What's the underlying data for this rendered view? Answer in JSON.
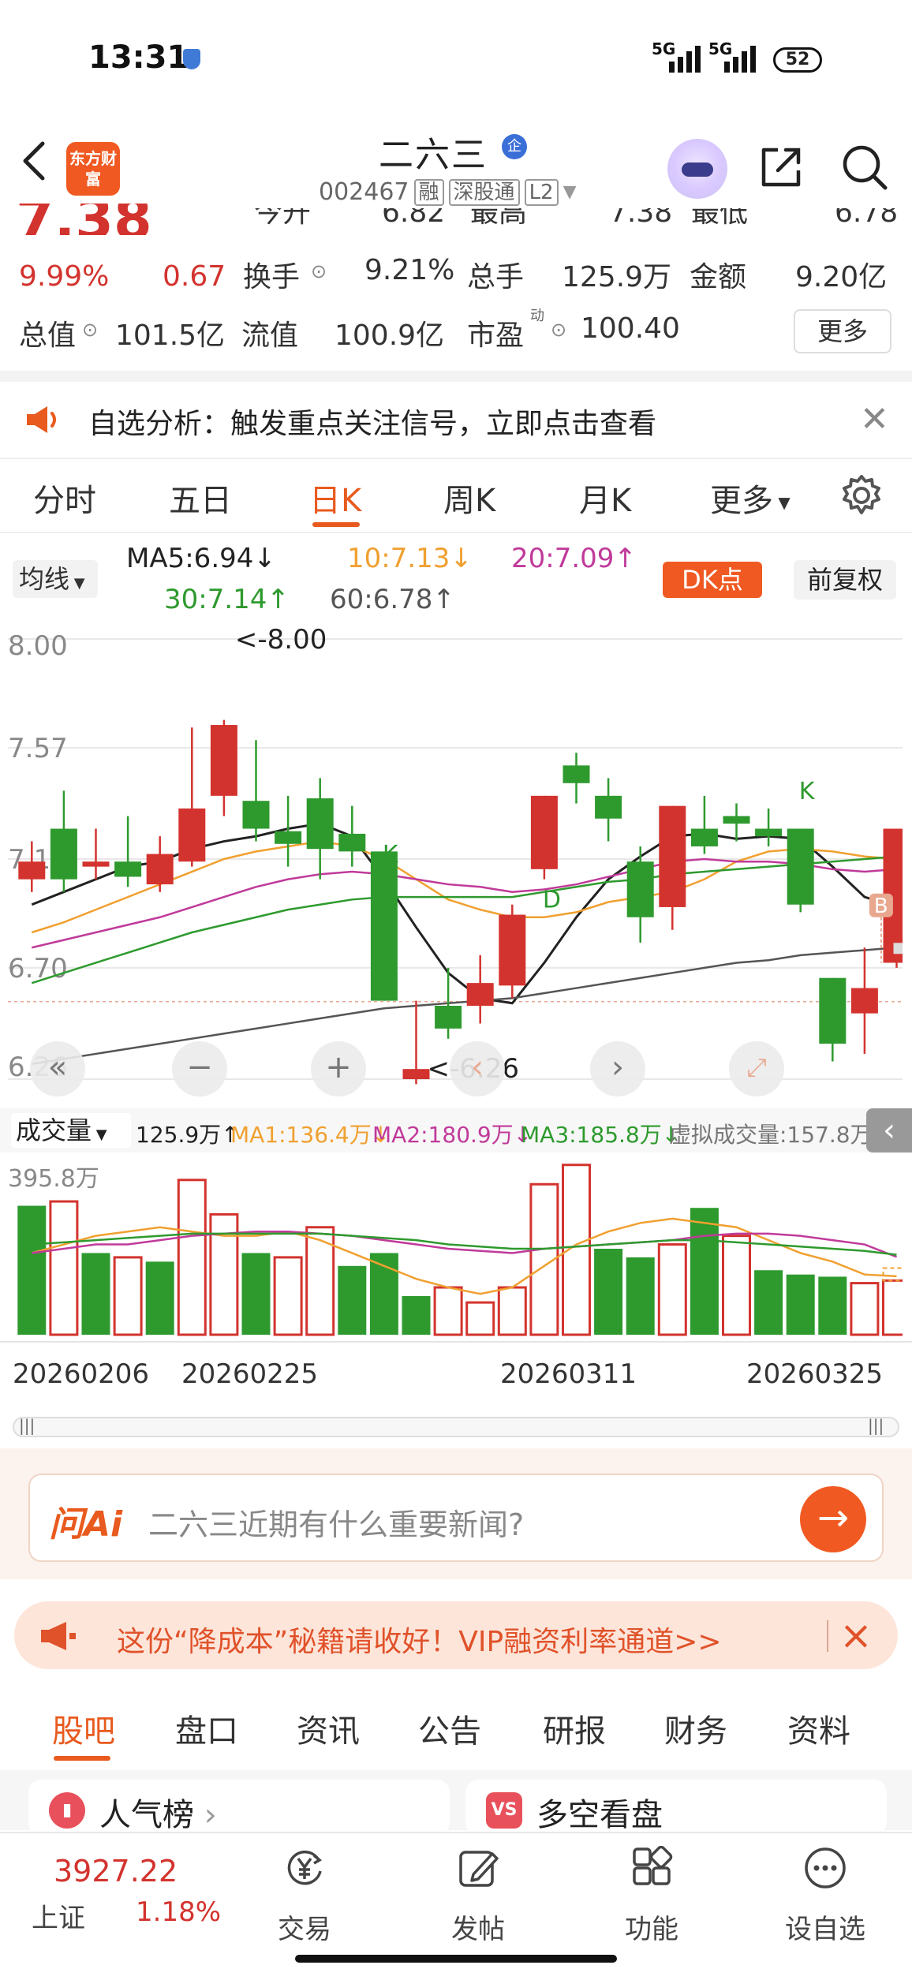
{
  "status": {
    "time": "13:31",
    "net1": "5G",
    "net2": "5G",
    "battery": "52"
  },
  "header": {
    "logo": "东方财富",
    "title": "二六三",
    "badge": "企",
    "code": "002467",
    "tags": [
      "融",
      "深股通",
      "L2"
    ]
  },
  "quote": {
    "price": "7.38",
    "change_pct": "9.99%",
    "change": "0.67",
    "row0": [
      "今开",
      "6.82",
      "最高",
      "7.38",
      "最低",
      "6.78"
    ],
    "turnover_label": "换手",
    "turnover": "9.21%",
    "volume_label": "总手",
    "volume": "125.9万",
    "amount_label": "金额",
    "amount": "9.20亿",
    "mktcap_label": "总值",
    "mktcap": "101.5亿",
    "float_label": "流值",
    "float": "100.9亿",
    "pe_label": "市盈",
    "pe_sup": "动",
    "pe": "100.40",
    "more": "更多"
  },
  "alert": {
    "text": "自选分析：触发重点关注信号，立即点击查看"
  },
  "tabs": [
    "分时",
    "五日",
    "日K",
    "周K",
    "月K",
    "更多"
  ],
  "active_tab": "日K",
  "ma": {
    "selector": "均线",
    "ma5": "MA5:6.94↓",
    "ma10": "10:7.13↓",
    "ma20": "20:7.09↑",
    "ma30": "30:7.14↑",
    "ma60": "60:6.78↑",
    "dk": "DK点",
    "adjust": "前复权"
  },
  "chart_data": {
    "type": "candlestick",
    "y_ticks": [
      "8.00",
      "7.57",
      "7.13",
      "6.70",
      "6.26"
    ],
    "ylim": [
      6.26,
      8.0
    ],
    "max_label": "<-8.00",
    "min_label": "<-6.26",
    "markers": [
      "K",
      "D",
      "K",
      "B"
    ],
    "candles": [
      {
        "o": 7.05,
        "c": 7.12,
        "h": 7.2,
        "l": 7.0
      },
      {
        "o": 7.25,
        "c": 7.05,
        "h": 7.4,
        "l": 7.0
      },
      {
        "o": 7.1,
        "c": 7.12,
        "h": 7.25,
        "l": 7.05
      },
      {
        "o": 7.12,
        "c": 7.06,
        "h": 7.3,
        "l": 7.02
      },
      {
        "o": 7.03,
        "c": 7.15,
        "h": 7.22,
        "l": 7.0
      },
      {
        "o": 7.12,
        "c": 7.33,
        "h": 7.65,
        "l": 7.1
      },
      {
        "o": 7.38,
        "c": 7.66,
        "h": 7.68,
        "l": 7.3
      },
      {
        "o": 7.36,
        "c": 7.25,
        "h": 7.6,
        "l": 7.2
      },
      {
        "o": 7.24,
        "c": 7.19,
        "h": 7.38,
        "l": 7.1
      },
      {
        "o": 7.37,
        "c": 7.17,
        "h": 7.45,
        "l": 7.05
      },
      {
        "o": 7.23,
        "c": 7.16,
        "h": 7.34,
        "l": 7.1
      },
      {
        "o": 7.16,
        "c": 6.57,
        "h": 7.16,
        "l": 6.57
      },
      {
        "o": 6.26,
        "c": 6.3,
        "h": 6.57,
        "l": 6.24
      },
      {
        "o": 6.55,
        "c": 6.46,
        "h": 6.7,
        "l": 6.42
      },
      {
        "o": 6.55,
        "c": 6.64,
        "h": 6.75,
        "l": 6.48
      },
      {
        "o": 6.63,
        "c": 6.91,
        "h": 6.95,
        "l": 6.58
      },
      {
        "o": 7.09,
        "c": 7.38,
        "h": 7.38,
        "l": 7.05
      },
      {
        "o": 7.5,
        "c": 7.43,
        "h": 7.55,
        "l": 7.35
      },
      {
        "o": 7.38,
        "c": 7.29,
        "h": 7.45,
        "l": 7.2
      },
      {
        "o": 7.12,
        "c": 6.9,
        "h": 7.18,
        "l": 6.8
      },
      {
        "o": 6.94,
        "c": 7.34,
        "h": 7.34,
        "l": 6.85
      },
      {
        "o": 7.25,
        "c": 7.18,
        "h": 7.38,
        "l": 7.15
      },
      {
        "o": 7.3,
        "c": 7.27,
        "h": 7.35,
        "l": 7.2
      },
      {
        "o": 7.25,
        "c": 7.22,
        "h": 7.33,
        "l": 7.18
      },
      {
        "o": 7.25,
        "c": 6.95,
        "h": 7.25,
        "l": 6.92
      },
      {
        "o": 6.66,
        "c": 6.4,
        "h": 6.66,
        "l": 6.33
      },
      {
        "o": 6.52,
        "c": 6.62,
        "h": 6.78,
        "l": 6.36
      },
      {
        "o": 6.72,
        "c": 7.25,
        "h": 7.25,
        "l": 6.7
      }
    ],
    "series": [
      {
        "name": "MA5",
        "color": "#222222",
        "values": [
          6.95,
          7.0,
          7.05,
          7.1,
          7.12,
          7.17,
          7.2,
          7.22,
          7.25,
          7.27,
          7.22,
          7.05,
          6.86,
          6.68,
          6.58,
          6.56,
          6.72,
          6.9,
          7.05,
          7.14,
          7.22,
          7.23,
          7.21,
          7.22,
          7.21,
          7.1,
          6.98,
          6.94
        ]
      },
      {
        "name": "MA10",
        "color": "#f0a030",
        "values": [
          6.84,
          6.88,
          6.93,
          6.98,
          7.03,
          7.08,
          7.13,
          7.16,
          7.18,
          7.2,
          7.18,
          7.13,
          7.05,
          6.97,
          6.93,
          6.9,
          6.9,
          6.92,
          6.96,
          6.98,
          7.0,
          7.05,
          7.12,
          7.16,
          7.17,
          7.16,
          7.14,
          7.13
        ]
      },
      {
        "name": "MA20",
        "color": "#c03a9a",
        "values": [
          6.78,
          6.81,
          6.84,
          6.87,
          6.9,
          6.94,
          6.98,
          7.02,
          7.05,
          7.07,
          7.08,
          7.07,
          7.05,
          7.03,
          7.02,
          7.0,
          7.01,
          7.03,
          7.06,
          7.09,
          7.12,
          7.13,
          7.12,
          7.12,
          7.11,
          7.09,
          7.08,
          7.09
        ]
      },
      {
        "name": "MA30",
        "color": "#2e9a2e",
        "values": [
          6.64,
          6.68,
          6.72,
          6.76,
          6.8,
          6.84,
          6.87,
          6.9,
          6.93,
          6.95,
          6.97,
          6.98,
          6.98,
          6.98,
          6.98,
          6.98,
          7.0,
          7.02,
          7.04,
          7.05,
          7.07,
          7.08,
          7.09,
          7.1,
          7.11,
          7.12,
          7.13,
          7.14
        ]
      },
      {
        "name": "MA60",
        "color": "#555555",
        "values": [
          6.32,
          6.34,
          6.36,
          6.38,
          6.4,
          6.42,
          6.44,
          6.46,
          6.48,
          6.5,
          6.52,
          6.54,
          6.55,
          6.56,
          6.57,
          6.58,
          6.6,
          6.62,
          6.64,
          6.66,
          6.68,
          6.7,
          6.72,
          6.73,
          6.75,
          6.76,
          6.77,
          6.78
        ]
      }
    ]
  },
  "volume": {
    "selector": "成交量",
    "total": "125.9万↑",
    "ma1": "MA1:136.4万↓",
    "ma2": "MA2:180.9万↓",
    "ma3": "MA3:185.8万↓",
    "virtual": "虚拟成交量:157.8万",
    "max_label": "395.8万",
    "bars": [
      {
        "v": 3.0,
        "up": false
      },
      {
        "v": 3.1,
        "up": true
      },
      {
        "v": 1.9,
        "up": false
      },
      {
        "v": 1.8,
        "up": true
      },
      {
        "v": 1.7,
        "up": false
      },
      {
        "v": 3.6,
        "up": true
      },
      {
        "v": 2.8,
        "up": true
      },
      {
        "v": 1.9,
        "up": false
      },
      {
        "v": 1.8,
        "up": true
      },
      {
        "v": 2.5,
        "up": true
      },
      {
        "v": 1.6,
        "up": false
      },
      {
        "v": 1.9,
        "up": false
      },
      {
        "v": 0.9,
        "up": false
      },
      {
        "v": 1.1,
        "up": true
      },
      {
        "v": 0.75,
        "up": true
      },
      {
        "v": 1.1,
        "up": true
      },
      {
        "v": 3.5,
        "up": true
      },
      {
        "v": 3.95,
        "up": true
      },
      {
        "v": 2.0,
        "up": false
      },
      {
        "v": 1.8,
        "up": false
      },
      {
        "v": 2.1,
        "up": true
      },
      {
        "v": 2.95,
        "up": false
      },
      {
        "v": 2.3,
        "up": true
      },
      {
        "v": 1.5,
        "up": false
      },
      {
        "v": 1.4,
        "up": false
      },
      {
        "v": 1.35,
        "up": false
      },
      {
        "v": 1.2,
        "up": true
      },
      {
        "v": 1.26,
        "up": true
      }
    ],
    "ma_lines": [
      {
        "color": "#f0a030",
        "values": [
          1.9,
          2.1,
          2.3,
          2.4,
          2.5,
          2.4,
          2.3,
          2.3,
          2.4,
          2.2,
          1.9,
          1.6,
          1.3,
          1.1,
          0.95,
          1.1,
          1.6,
          2.1,
          2.4,
          2.6,
          2.7,
          2.6,
          2.5,
          2.2,
          1.9,
          1.7,
          1.4,
          1.36
        ]
      },
      {
        "color": "#c03a9a",
        "values": [
          1.9,
          2.0,
          2.1,
          2.1,
          2.2,
          2.3,
          2.35,
          2.4,
          2.4,
          2.35,
          2.3,
          2.2,
          2.1,
          2.0,
          1.95,
          1.9,
          2.0,
          2.05,
          2.1,
          2.15,
          2.2,
          2.3,
          2.35,
          2.35,
          2.3,
          2.2,
          2.1,
          1.81
        ]
      },
      {
        "color": "#2e9a2e",
        "values": [
          2.1,
          2.15,
          2.2,
          2.25,
          2.3,
          2.35,
          2.35,
          2.35,
          2.35,
          2.35,
          2.3,
          2.25,
          2.2,
          2.1,
          2.05,
          2.0,
          2.0,
          2.05,
          2.1,
          2.15,
          2.2,
          2.2,
          2.15,
          2.1,
          2.05,
          2.0,
          1.95,
          1.86
        ]
      }
    ]
  },
  "dates": [
    "20260206",
    "20260225",
    "20260311",
    "20260325"
  ],
  "ask": {
    "brand": "问Ai",
    "placeholder": "二六三近期有什么重要新闻?"
  },
  "promo": {
    "text": "这份“降成本”秘籍请收好！VIP融资利率通道>>"
  },
  "bottom_tabs": [
    "股吧",
    "盘口",
    "资讯",
    "公告",
    "研报",
    "财务",
    "资料"
  ],
  "cards": [
    {
      "label": "人气榜",
      "icon": "chart-icon"
    },
    {
      "label": "多空看盘",
      "icon": "vs-icon"
    }
  ],
  "tabbar": {
    "index_value": "3927.22",
    "index_name": "上证",
    "index_pct": "1.18%",
    "items": [
      "交易",
      "发帖",
      "功能",
      "设自选"
    ]
  }
}
